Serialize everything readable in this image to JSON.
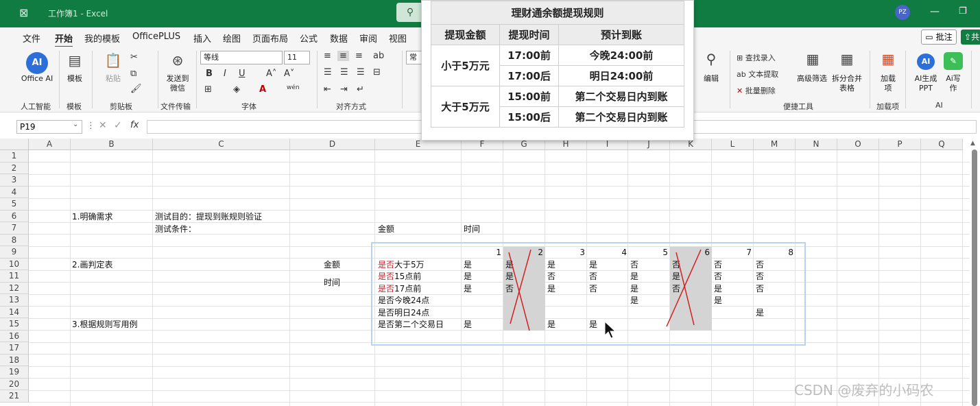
{
  "window": {
    "title": "工作簿1 - Excel",
    "avatar": "PZ"
  },
  "menu": [
    "文件",
    "开始",
    "我的模板",
    "OfficePLUS",
    "插入",
    "绘图",
    "页面布局",
    "公式",
    "数据",
    "审阅",
    "视图"
  ],
  "menu_active": "开始",
  "menu_right": {
    "comment": "批注",
    "share": "共"
  },
  "ribbon": {
    "office_ai": "Office AI",
    "template": "模板",
    "paste": "粘贴",
    "send_wechat": "发送到微信",
    "font_name": "等线",
    "font_size": "11",
    "number_format": "常规",
    "groups": {
      "ai": "人工智能",
      "template": "模板",
      "clipboard": "剪贴板",
      "file_transfer": "文件传输",
      "font": "字体",
      "align": "对齐方式",
      "quick_tools": "便捷工具",
      "addins": "加载项",
      "ai2": "AI"
    },
    "edit": "编辑",
    "find_input": "查找录入",
    "text_extract": "文本提取",
    "batch_delete": "批量删除",
    "advanced_filter": "高级筛选",
    "split_merge": "拆分合并表格",
    "addin": "加载项",
    "ai_ppt": "AI生成PPT",
    "ai_write": "Ai写作"
  },
  "formula_bar": {
    "name_box": "P19",
    "fx": "fx"
  },
  "columns": [
    "A",
    "B",
    "C",
    "D",
    "E",
    "F",
    "G",
    "H",
    "I",
    "J",
    "K",
    "L",
    "M",
    "N",
    "O",
    "P",
    "Q"
  ],
  "rows": [
    "1",
    "2",
    "3",
    "4",
    "5",
    "6",
    "7",
    "8",
    "9",
    "10",
    "11",
    "12",
    "13",
    "14",
    "15",
    "16",
    "17",
    "18",
    "19",
    "20",
    "21"
  ],
  "cells": {
    "b6": "1.明确需求",
    "c6": "测试目的：提现到账规则验证",
    "c7": "测试条件：",
    "e7": "金额",
    "f7": "时间",
    "b10": "2.画判定表",
    "d10": "金额",
    "d11": "时间",
    "b15": "3.根据规则写用例",
    "cond_prefix": "是否",
    "conditions": [
      "大于5万",
      "15点前",
      "17点前"
    ],
    "actions": [
      "是否今晚24点",
      "是否明日24点",
      "是否第二个交易日"
    ],
    "rule_numbers": [
      "1",
      "2",
      "3",
      "4",
      "5",
      "6",
      "7",
      "8"
    ],
    "rules": [
      [
        "是",
        "是",
        "是",
        "是",
        "否",
        "否",
        "否",
        "否"
      ],
      [
        "是",
        "是",
        "否",
        "否",
        "是",
        "是",
        "否",
        "否"
      ],
      [
        "是",
        "否",
        "是",
        "否",
        "是",
        "否",
        "是",
        "否"
      ],
      [
        "",
        "",
        "",
        "",
        "是",
        "",
        "是",
        ""
      ],
      [
        "",
        "",
        "",
        "",
        "",
        "",
        "",
        "是"
      ],
      [
        "是",
        "",
        "是",
        "是",
        "",
        "",
        "",
        ""
      ]
    ]
  },
  "popup": {
    "title": "理财通余额提现规则",
    "headers": [
      "提现金额",
      "提现时间",
      "预计到账"
    ],
    "rows": [
      {
        "amount": "小于5万元",
        "time": "17:00前",
        "arrival": "今晚24:00前"
      },
      {
        "amount": "",
        "time": "17:00后",
        "arrival": "明日24:00前"
      },
      {
        "amount": "大于5万元",
        "time": "15:00前",
        "arrival": "第二个交易日内到账"
      },
      {
        "amount": "",
        "time": "15:00后",
        "arrival": "第二个交易日内到账"
      }
    ]
  },
  "watermark": "CSDN @废弃的小码农"
}
